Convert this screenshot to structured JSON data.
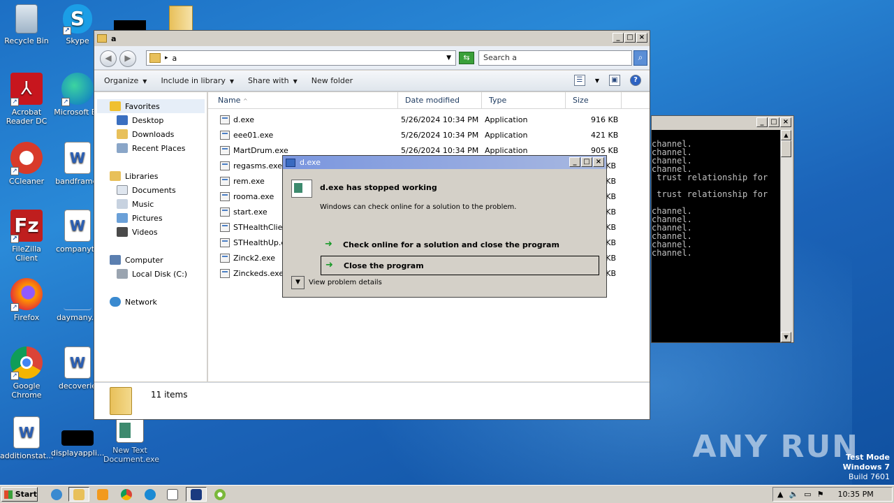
{
  "desktop": {
    "icons": [
      {
        "label": "Recycle Bin"
      },
      {
        "label": "Skype"
      },
      {
        "label": "Acrobat Reader DC"
      },
      {
        "label": "Microsoft Ed"
      },
      {
        "label": "CCleaner"
      },
      {
        "label": "bandframe."
      },
      {
        "label": "FileZilla Client"
      },
      {
        "label": "companyth"
      },
      {
        "label": "Firefox"
      },
      {
        "label": "daymany.p"
      },
      {
        "label": "Google Chrome"
      },
      {
        "label": "decoverie"
      },
      {
        "label": "additionstat..."
      },
      {
        "label": "displayappli..."
      },
      {
        "label": "New Text Document.exe"
      }
    ]
  },
  "explorer": {
    "title": "a",
    "address": "a",
    "search_placeholder": "Search a",
    "toolbar": {
      "organize": "Organize",
      "include": "Include in library",
      "share": "Share with",
      "newfolder": "New folder"
    },
    "nav": {
      "favorites": "Favorites",
      "desktop": "Desktop",
      "downloads": "Downloads",
      "recent": "Recent Places",
      "libraries": "Libraries",
      "documents": "Documents",
      "music": "Music",
      "pictures": "Pictures",
      "videos": "Videos",
      "computer": "Computer",
      "localdisk": "Local Disk (C:)",
      "network": "Network"
    },
    "columns": {
      "name": "Name",
      "date": "Date modified",
      "type": "Type",
      "size": "Size"
    },
    "files": [
      {
        "name": "d.exe",
        "date": "5/26/2024 10:34 PM",
        "type": "Application",
        "size": "916 KB"
      },
      {
        "name": "eee01.exe",
        "date": "5/26/2024 10:34 PM",
        "type": "Application",
        "size": "421 KB"
      },
      {
        "name": "MartDrum.exe",
        "date": "5/26/2024 10:34 PM",
        "type": "Application",
        "size": "905 KB"
      },
      {
        "name": "regasms.exe",
        "date": "",
        "type": "",
        "size": "KB"
      },
      {
        "name": "rem.exe",
        "date": "",
        "type": "",
        "size": "KB"
      },
      {
        "name": "rooma.exe",
        "date": "",
        "type": "",
        "size": "KB"
      },
      {
        "name": "start.exe",
        "date": "",
        "type": "",
        "size": "KB"
      },
      {
        "name": "STHealthClient",
        "date": "",
        "type": "",
        "size": "KB"
      },
      {
        "name": "STHealthUp.ex",
        "date": "",
        "type": "",
        "size": "KB"
      },
      {
        "name": "Zinck2.exe",
        "date": "",
        "type": "",
        "size": "KB"
      },
      {
        "name": "Zinckeds.exe",
        "date": "",
        "type": "",
        "size": "KB"
      }
    ],
    "status": "11 items"
  },
  "console": {
    "lines": "channel.\nchannel.\nchannel.\nchannel.\n trust relationship for\n\n trust relationship for\n\nchannel.\nchannel.\nchannel.\nchannel.\nchannel.\nchannel."
  },
  "dialog": {
    "title": "d.exe",
    "heading": "d.exe has stopped working",
    "subtext": "Windows can check online for a solution to the problem.",
    "option1": "Check online for a solution and close the program",
    "option2": "Close the program",
    "details": "View problem details"
  },
  "taskbar": {
    "start": "Start",
    "clock": "10:35 PM"
  },
  "watermark": "ANY RUN",
  "testmode": {
    "line1": "Test Mode",
    "line2": "Windows 7",
    "line3": "Build 7601"
  }
}
